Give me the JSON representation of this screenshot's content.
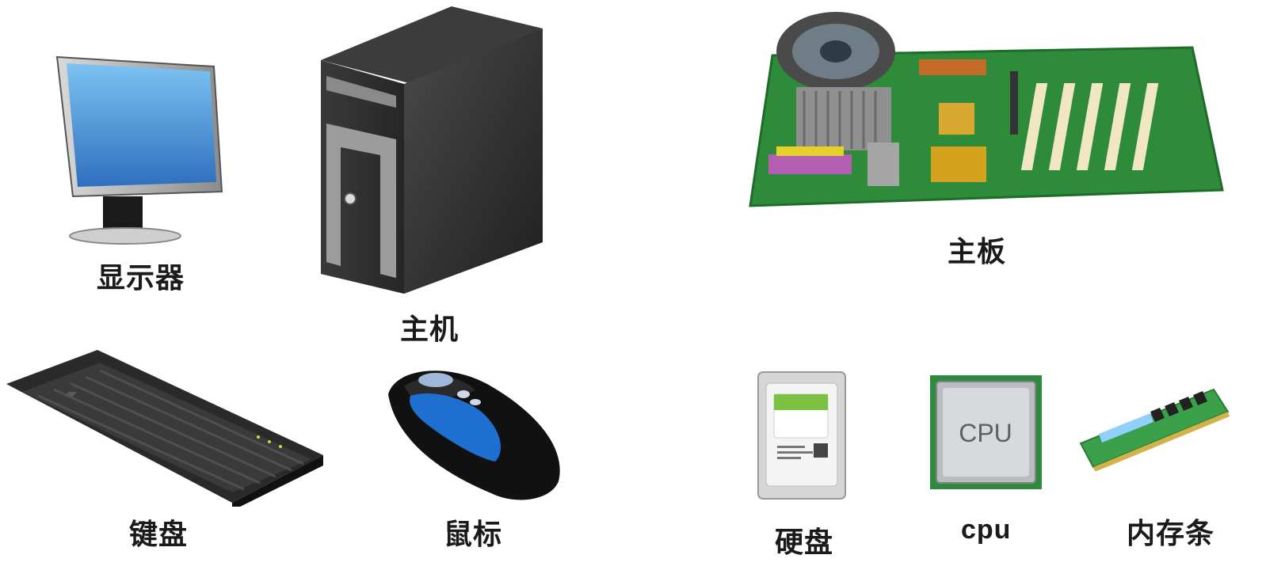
{
  "items": {
    "monitor": {
      "label": "显示器",
      "icon": "monitor-icon"
    },
    "tower": {
      "label": "主机",
      "icon": "computer-tower-icon"
    },
    "keyboard": {
      "label": "键盘",
      "icon": "keyboard-icon"
    },
    "mouse": {
      "label": "鼠标",
      "icon": "mouse-icon"
    },
    "motherboard": {
      "label": "主板",
      "icon": "motherboard-icon"
    },
    "hdd": {
      "label": "硬盘",
      "icon": "hard-drive-icon"
    },
    "cpu": {
      "label": "cpu",
      "chip_text": "CPU",
      "icon": "cpu-chip-icon"
    },
    "ram": {
      "label": "内存条",
      "icon": "ram-stick-icon"
    }
  },
  "colors": {
    "screen_blue": "#3f8fd8",
    "pcb_green": "#2e8b3a",
    "mouse_blue": "#1f6fd1",
    "dark_case": "#2b2b2b"
  }
}
